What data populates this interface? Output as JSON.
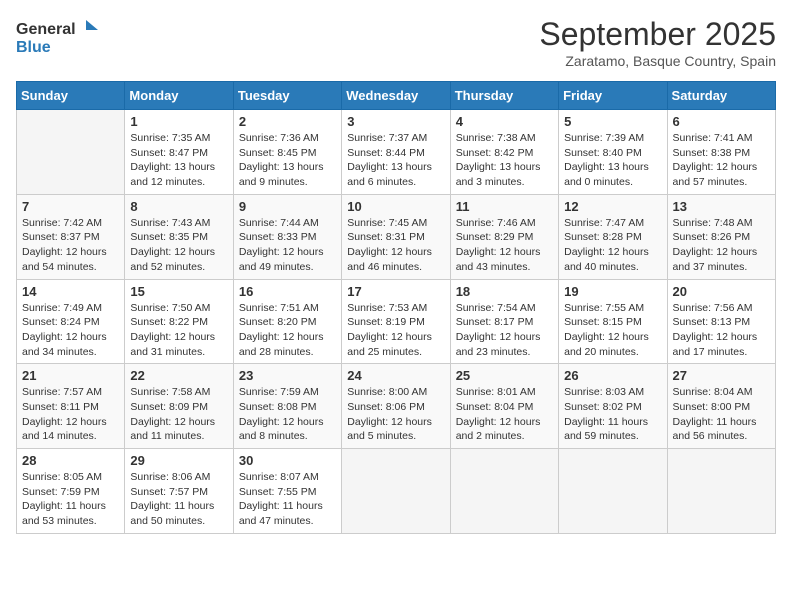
{
  "header": {
    "logo_general": "General",
    "logo_blue": "Blue",
    "month_title": "September 2025",
    "location": "Zaratamo, Basque Country, Spain"
  },
  "days_of_week": [
    "Sunday",
    "Monday",
    "Tuesday",
    "Wednesday",
    "Thursday",
    "Friday",
    "Saturday"
  ],
  "weeks": [
    [
      {
        "day": "",
        "info": ""
      },
      {
        "day": "1",
        "info": "Sunrise: 7:35 AM\nSunset: 8:47 PM\nDaylight: 13 hours\nand 12 minutes."
      },
      {
        "day": "2",
        "info": "Sunrise: 7:36 AM\nSunset: 8:45 PM\nDaylight: 13 hours\nand 9 minutes."
      },
      {
        "day": "3",
        "info": "Sunrise: 7:37 AM\nSunset: 8:44 PM\nDaylight: 13 hours\nand 6 minutes."
      },
      {
        "day": "4",
        "info": "Sunrise: 7:38 AM\nSunset: 8:42 PM\nDaylight: 13 hours\nand 3 minutes."
      },
      {
        "day": "5",
        "info": "Sunrise: 7:39 AM\nSunset: 8:40 PM\nDaylight: 13 hours\nand 0 minutes."
      },
      {
        "day": "6",
        "info": "Sunrise: 7:41 AM\nSunset: 8:38 PM\nDaylight: 12 hours\nand 57 minutes."
      }
    ],
    [
      {
        "day": "7",
        "info": "Sunrise: 7:42 AM\nSunset: 8:37 PM\nDaylight: 12 hours\nand 54 minutes."
      },
      {
        "day": "8",
        "info": "Sunrise: 7:43 AM\nSunset: 8:35 PM\nDaylight: 12 hours\nand 52 minutes."
      },
      {
        "day": "9",
        "info": "Sunrise: 7:44 AM\nSunset: 8:33 PM\nDaylight: 12 hours\nand 49 minutes."
      },
      {
        "day": "10",
        "info": "Sunrise: 7:45 AM\nSunset: 8:31 PM\nDaylight: 12 hours\nand 46 minutes."
      },
      {
        "day": "11",
        "info": "Sunrise: 7:46 AM\nSunset: 8:29 PM\nDaylight: 12 hours\nand 43 minutes."
      },
      {
        "day": "12",
        "info": "Sunrise: 7:47 AM\nSunset: 8:28 PM\nDaylight: 12 hours\nand 40 minutes."
      },
      {
        "day": "13",
        "info": "Sunrise: 7:48 AM\nSunset: 8:26 PM\nDaylight: 12 hours\nand 37 minutes."
      }
    ],
    [
      {
        "day": "14",
        "info": "Sunrise: 7:49 AM\nSunset: 8:24 PM\nDaylight: 12 hours\nand 34 minutes."
      },
      {
        "day": "15",
        "info": "Sunrise: 7:50 AM\nSunset: 8:22 PM\nDaylight: 12 hours\nand 31 minutes."
      },
      {
        "day": "16",
        "info": "Sunrise: 7:51 AM\nSunset: 8:20 PM\nDaylight: 12 hours\nand 28 minutes."
      },
      {
        "day": "17",
        "info": "Sunrise: 7:53 AM\nSunset: 8:19 PM\nDaylight: 12 hours\nand 25 minutes."
      },
      {
        "day": "18",
        "info": "Sunrise: 7:54 AM\nSunset: 8:17 PM\nDaylight: 12 hours\nand 23 minutes."
      },
      {
        "day": "19",
        "info": "Sunrise: 7:55 AM\nSunset: 8:15 PM\nDaylight: 12 hours\nand 20 minutes."
      },
      {
        "day": "20",
        "info": "Sunrise: 7:56 AM\nSunset: 8:13 PM\nDaylight: 12 hours\nand 17 minutes."
      }
    ],
    [
      {
        "day": "21",
        "info": "Sunrise: 7:57 AM\nSunset: 8:11 PM\nDaylight: 12 hours\nand 14 minutes."
      },
      {
        "day": "22",
        "info": "Sunrise: 7:58 AM\nSunset: 8:09 PM\nDaylight: 12 hours\nand 11 minutes."
      },
      {
        "day": "23",
        "info": "Sunrise: 7:59 AM\nSunset: 8:08 PM\nDaylight: 12 hours\nand 8 minutes."
      },
      {
        "day": "24",
        "info": "Sunrise: 8:00 AM\nSunset: 8:06 PM\nDaylight: 12 hours\nand 5 minutes."
      },
      {
        "day": "25",
        "info": "Sunrise: 8:01 AM\nSunset: 8:04 PM\nDaylight: 12 hours\nand 2 minutes."
      },
      {
        "day": "26",
        "info": "Sunrise: 8:03 AM\nSunset: 8:02 PM\nDaylight: 11 hours\nand 59 minutes."
      },
      {
        "day": "27",
        "info": "Sunrise: 8:04 AM\nSunset: 8:00 PM\nDaylight: 11 hours\nand 56 minutes."
      }
    ],
    [
      {
        "day": "28",
        "info": "Sunrise: 8:05 AM\nSunset: 7:59 PM\nDaylight: 11 hours\nand 53 minutes."
      },
      {
        "day": "29",
        "info": "Sunrise: 8:06 AM\nSunset: 7:57 PM\nDaylight: 11 hours\nand 50 minutes."
      },
      {
        "day": "30",
        "info": "Sunrise: 8:07 AM\nSunset: 7:55 PM\nDaylight: 11 hours\nand 47 minutes."
      },
      {
        "day": "",
        "info": ""
      },
      {
        "day": "",
        "info": ""
      },
      {
        "day": "",
        "info": ""
      },
      {
        "day": "",
        "info": ""
      }
    ]
  ]
}
